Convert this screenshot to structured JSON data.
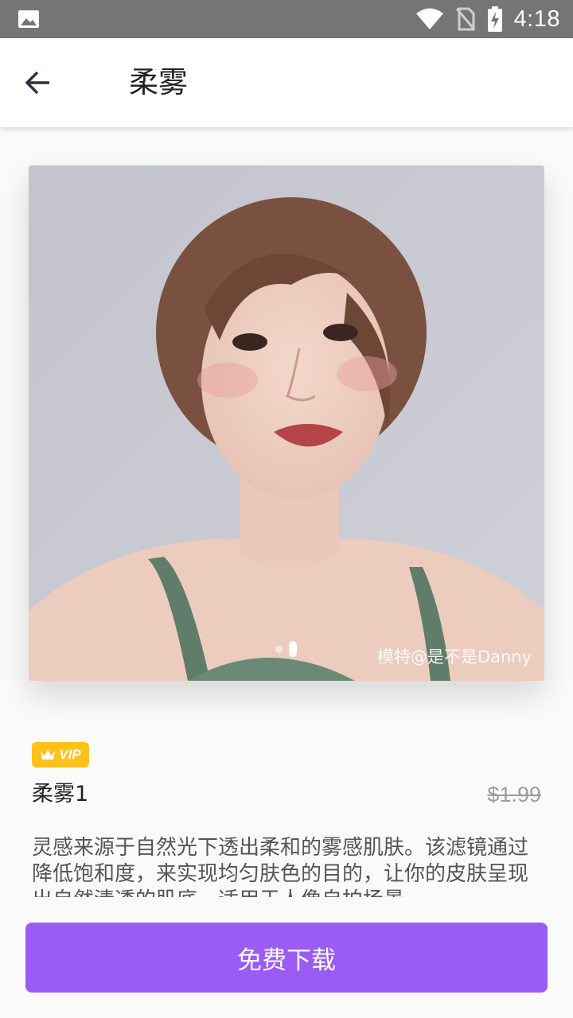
{
  "status_bar": {
    "time": "4:18",
    "icons": [
      "image-icon",
      "wifi-icon",
      "no-sim-icon",
      "battery-charging-icon"
    ]
  },
  "app_bar": {
    "title": "柔雾",
    "back_icon": "arrow-back-icon"
  },
  "preview": {
    "watermark": "模特@是不是Danny",
    "page_count": 2,
    "active_page": 2
  },
  "filter": {
    "vip_label": "VIP",
    "name": "柔雾1",
    "price": "$1.99",
    "description": "灵感来源于自然光下透出柔和的雾感肌肤。该滤镜通过降低饱和度，来实现均匀肤色的目的，让你的皮肤呈现出自然清透的肌底，适用于人像自拍场景。"
  },
  "actions": {
    "download_label": "免费下载"
  },
  "colors": {
    "accent": "#9a5cf5",
    "vip": "#ffc21a",
    "status_bar": "#757575"
  }
}
